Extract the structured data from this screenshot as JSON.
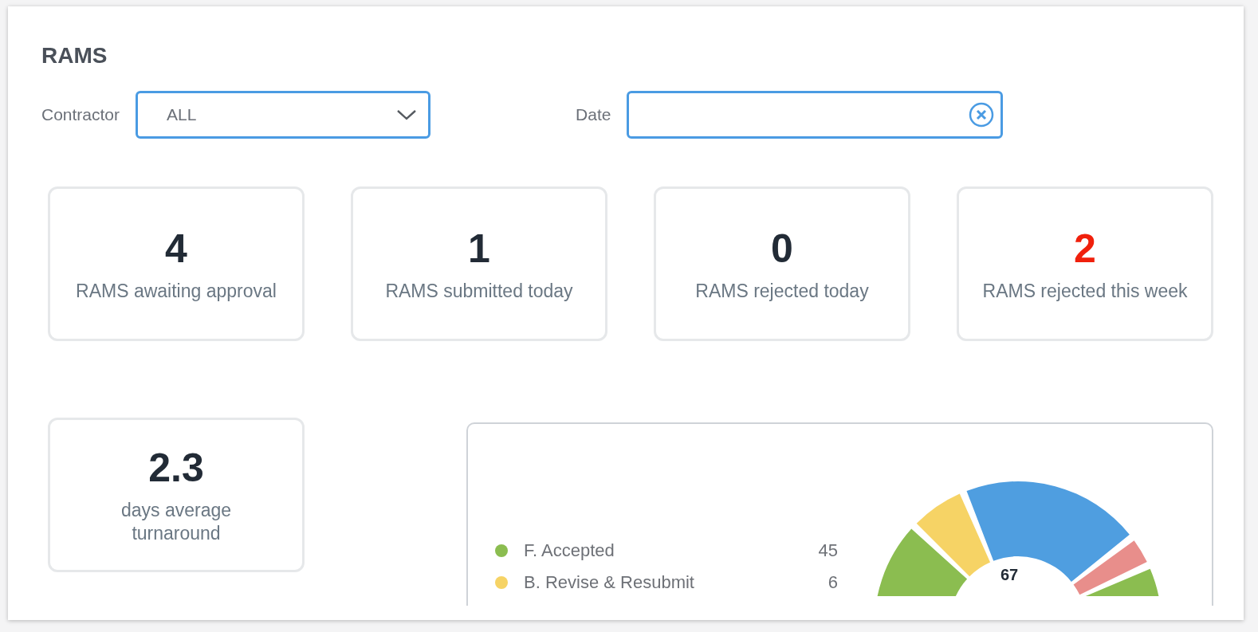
{
  "title": "RAMS",
  "filters": {
    "contractor": {
      "label": "Contractor",
      "value": "ALL"
    },
    "date": {
      "label": "Date"
    }
  },
  "stats": [
    {
      "value": "4",
      "label": "RAMS awaiting approval",
      "alert": false
    },
    {
      "value": "1",
      "label": "RAMS submitted today",
      "alert": false
    },
    {
      "value": "0",
      "label": "RAMS rejected today",
      "alert": false
    },
    {
      "value": "2",
      "label": "RAMS rejected this week",
      "alert": true
    },
    {
      "value": "2.3",
      "label": "days average turnaround",
      "alert": false
    }
  ],
  "status_panel": {
    "legend": [
      {
        "label": "F. Accepted",
        "count": "45",
        "color": "#8bbd50"
      },
      {
        "label": "B. Revise & Resubmit",
        "count": "6",
        "color": "#f6d365"
      }
    ],
    "total": "67"
  }
}
